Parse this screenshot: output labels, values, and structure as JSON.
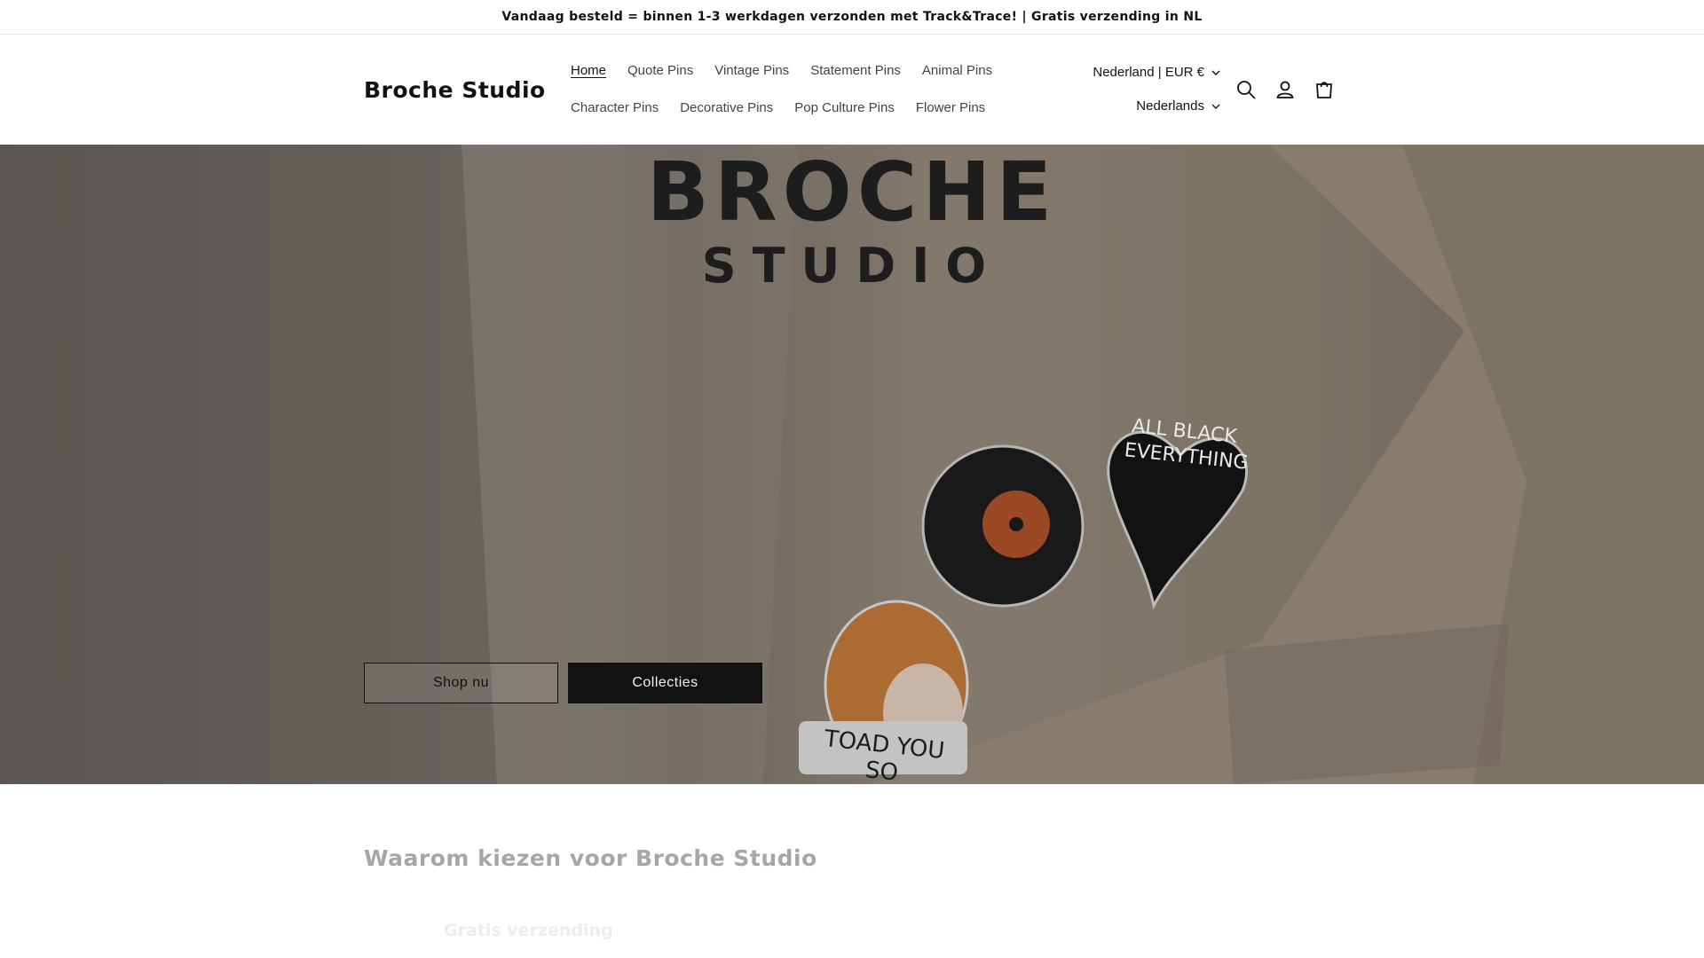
{
  "announcement": "Vandaag besteld = binnen 1-3 werkdagen verzonden met Track&Trace! | Gratis verzending in NL",
  "brand": "Broche Studio",
  "nav": {
    "row1": [
      "Home",
      "Quote Pins",
      "Vintage Pins",
      "Statement Pins",
      "Animal Pins"
    ],
    "row2": [
      "Character Pins",
      "Decorative Pins",
      "Pop Culture Pins",
      "Flower Pins"
    ],
    "active": "Home"
  },
  "selectors": {
    "country": "Nederland | EUR €",
    "language": "Nederlands"
  },
  "icons": {
    "search": "search-icon",
    "account": "account-icon",
    "cart": "cart-icon"
  },
  "hero": {
    "logo_line1": "BROCHE",
    "logo_line2": "STUDIO",
    "pin_text_1": "ALL BLACK EVERYTHING",
    "pin_text_2": "TOAD YOU SO",
    "btn_shop": "Shop nu",
    "btn_collections": "Collecties"
  },
  "section": {
    "title": "Waarom kiezen voor Broche Studio",
    "feature_1": "Gratis verzending"
  },
  "colors": {
    "primary": "#121212",
    "muted_heading": "#a6a6a6"
  }
}
